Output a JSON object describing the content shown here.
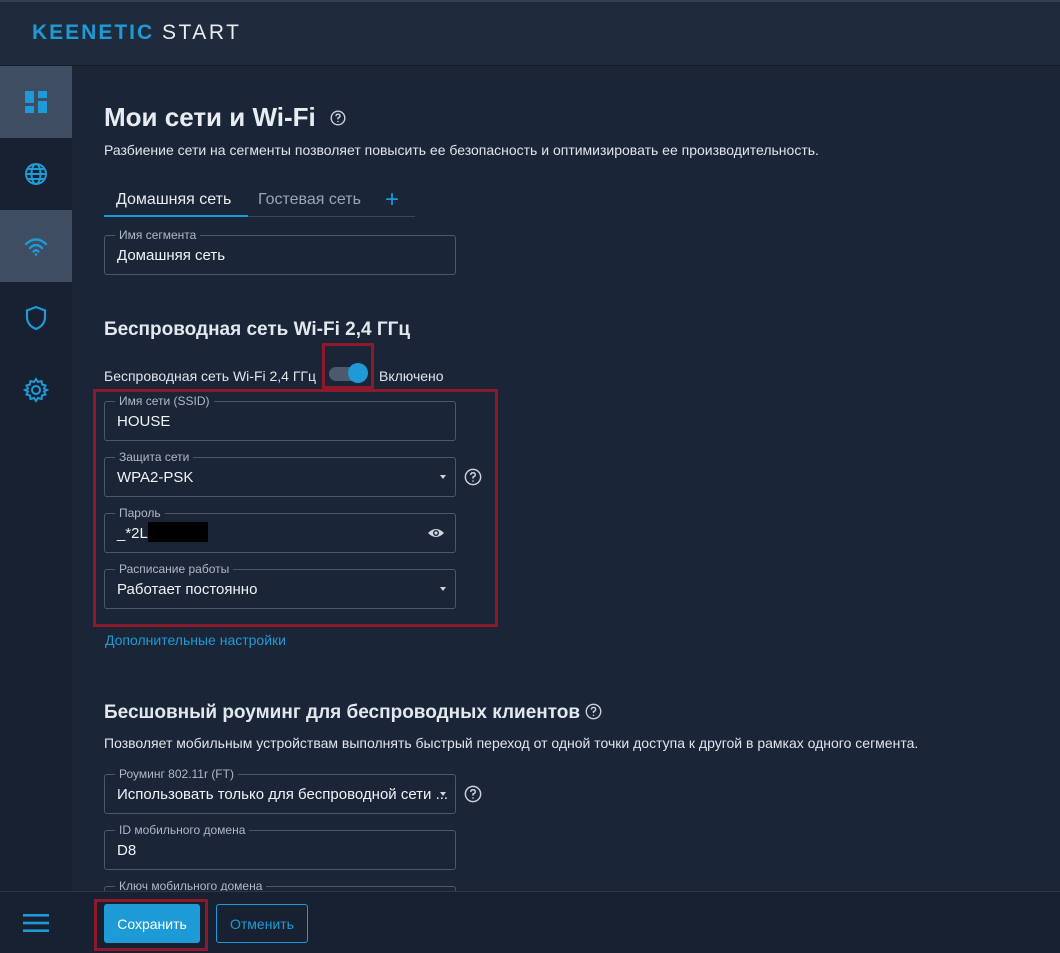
{
  "brand": {
    "part1": "KEENETIC",
    "part2": "START",
    "accent": "#1e9bd7"
  },
  "sidebar": {
    "items": [
      {
        "name": "dashboard",
        "icon": "dashboard-icon",
        "active": true
      },
      {
        "name": "internet",
        "icon": "globe-icon",
        "active": false
      },
      {
        "name": "wifi",
        "icon": "wifi-icon",
        "active": true
      },
      {
        "name": "security",
        "icon": "shield-icon",
        "active": false
      },
      {
        "name": "settings",
        "icon": "gear-icon",
        "active": false
      }
    ],
    "menu_icon": "hamburger-icon"
  },
  "page": {
    "title": "Мои сети и Wi-Fi",
    "description": "Разбиение сети на сегменты позволяет повысить ее безопасность и оптимизировать ее производительность."
  },
  "tabs": [
    {
      "label": "Домашняя сеть",
      "active": true
    },
    {
      "label": "Гостевая сеть",
      "active": false
    }
  ],
  "segment": {
    "label": "Имя сегмента",
    "value": "Домашняя сеть"
  },
  "wifi24": {
    "heading": "Беспроводная сеть Wi-Fi 2,4 ГГц",
    "toggle_label": "Беспроводная сеть Wi-Fi 2,4 ГГц",
    "toggle_state": "Включено",
    "ssid": {
      "label": "Имя сети (SSID)",
      "value": "HOUSE"
    },
    "security": {
      "label": "Защита сети",
      "value": "WPA2-PSK"
    },
    "password": {
      "label": "Пароль",
      "value": "_*2L2"
    },
    "schedule": {
      "label": "Расписание работы",
      "value": "Работает постоянно"
    },
    "advanced_link": "Дополнительные настройки"
  },
  "roaming": {
    "heading": "Бесшовный роуминг для беспроводных клиентов",
    "description": "Позволяет мобильным устройствам выполнять быстрый переход от одной точки доступа к другой в рамках одного сегмента.",
    "mode": {
      "label": "Роуминг 802.11r (FT)",
      "value": "Использовать только для беспроводной сети ..."
    },
    "domain_id": {
      "label": "ID мобильного домена",
      "value": "D8"
    },
    "domain_key": {
      "label": "Ключ мобильного домена"
    }
  },
  "footer": {
    "save_label": "Сохранить",
    "cancel_label": "Отменить"
  }
}
